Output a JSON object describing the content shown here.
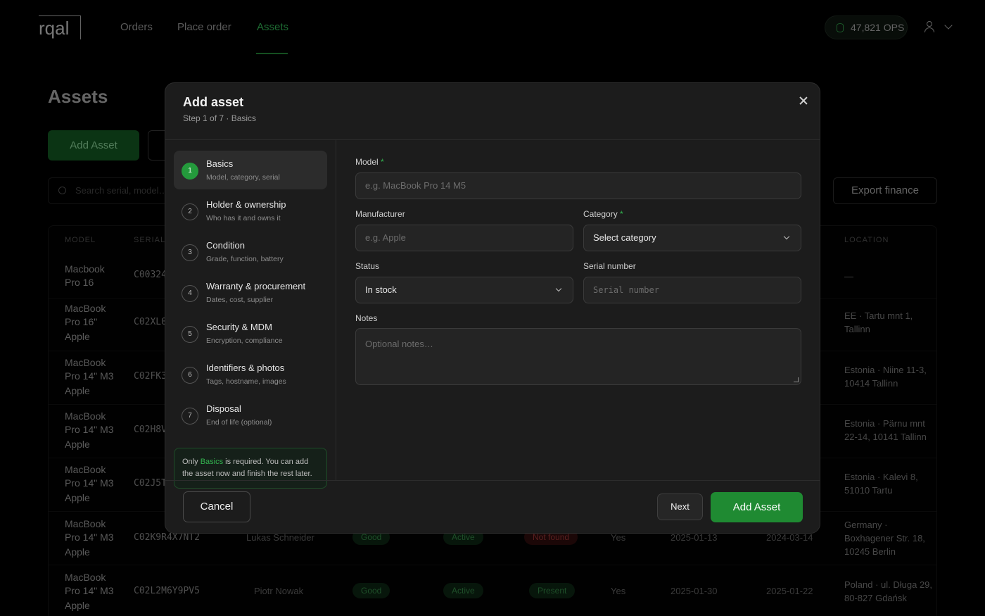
{
  "app": {
    "logo": "rqal",
    "nav": [
      "Orders",
      "Place order",
      "Assets"
    ],
    "ops_balance": "47,821 OPS"
  },
  "page": {
    "title": "Assets",
    "add_button": "Add Asset",
    "search_placeholder": "Search serial, model…",
    "export_button": "Export finance",
    "columns": [
      "MODEL",
      "SERIAL",
      "LOCATION"
    ],
    "rows": [
      {
        "model": "Macbook Pro 16",
        "maker": "",
        "serial": "C00324",
        "location": "—"
      },
      {
        "model": "MacBook Pro 16\"",
        "maker": "Apple",
        "serial": "C02XL0",
        "location": "EE · Tartu mnt 1, Tallinn"
      },
      {
        "model": "MacBook Pro 14\" M3",
        "maker": "Apple",
        "serial": "C02FK3",
        "location": "Estonia · Niine 11-3, 10414 Tallinn"
      },
      {
        "model": "MacBook Pro 14\" M3",
        "maker": "Apple",
        "serial": "C02H8V",
        "location": "Estonia · Pärnu mnt 22-14, 10141 Tallinn"
      },
      {
        "model": "MacBook Pro 14\" M3",
        "maker": "Apple",
        "serial": "C02J5T",
        "location": "Estonia · Kalevi 8, 51010 Tartu"
      },
      {
        "model": "MacBook Pro 14\" M3",
        "maker": "Apple",
        "serial": "C02K9R4X7NT2",
        "holder": "Lukas Schneider",
        "grade": "Good",
        "state": "Active",
        "presence": "Not found",
        "flag": "Yes",
        "date1": "2025-01-13",
        "date2": "2024-03-14",
        "location": "Germany · Boxhagener Str. 18, 10245 Berlin"
      },
      {
        "model": "MacBook Pro 14\" M3",
        "maker": "Apple",
        "serial": "C02L2M6Y9PV5",
        "holder": "Piotr Nowak",
        "grade": "Good",
        "state": "Active",
        "presence": "Present",
        "flag": "Yes",
        "date1": "2025-01-30",
        "date2": "2025-01-22",
        "location": "Poland · ul. Długa 29, 80-827 Gdańsk"
      }
    ]
  },
  "modal": {
    "title": "Add asset",
    "subtitle": "Step 1 of 7 · Basics",
    "steps": [
      {
        "num": "1",
        "title": "Basics",
        "desc": "Model, category, serial"
      },
      {
        "num": "2",
        "title": "Holder & ownership",
        "desc": "Who has it and owns it"
      },
      {
        "num": "3",
        "title": "Condition",
        "desc": "Grade, function, battery"
      },
      {
        "num": "4",
        "title": "Warranty & procurement",
        "desc": "Dates, cost, supplier"
      },
      {
        "num": "5",
        "title": "Security & MDM",
        "desc": "Encryption, compliance"
      },
      {
        "num": "6",
        "title": "Identifiers & photos",
        "desc": "Tags, hostname, images"
      },
      {
        "num": "7",
        "title": "Disposal",
        "desc": "End of life (optional)"
      }
    ],
    "note": {
      "prefix": "Only ",
      "highlight": "Basics",
      "suffix": " is required. You can add the asset now and finish the rest later."
    },
    "fields": {
      "model_label": "Model",
      "model_placeholder": "e.g. MacBook Pro 14 M5",
      "manufacturer_label": "Manufacturer",
      "manufacturer_placeholder": "e.g. Apple",
      "category_label": "Category",
      "category_value": "Select category",
      "status_label": "Status",
      "status_value": "In stock",
      "serial_label": "Serial number",
      "serial_placeholder": "Serial number",
      "notes_label": "Notes",
      "notes_placeholder": "Optional notes…",
      "required_mark": "*"
    },
    "buttons": {
      "cancel": "Cancel",
      "next": "Next",
      "add": "Add Asset"
    }
  },
  "colors": {
    "accent": "#1f8a32",
    "accent_text": "#33b34f",
    "modal_bg": "#1c1c1c"
  }
}
